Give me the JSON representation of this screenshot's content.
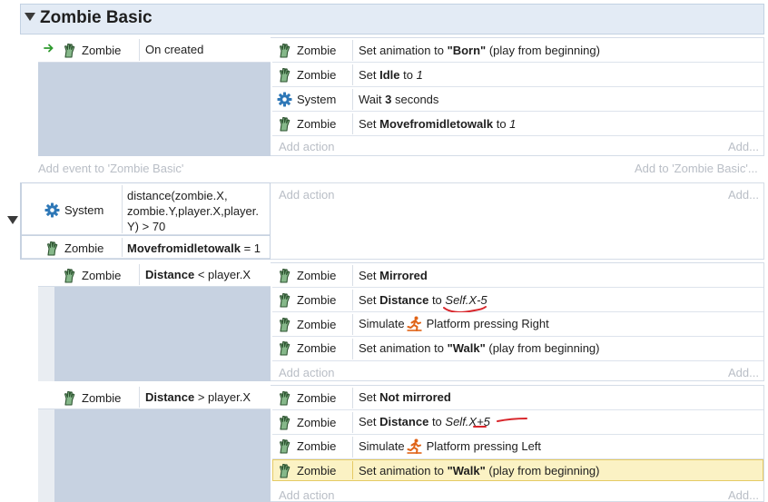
{
  "group": {
    "title": "Zombie Basic"
  },
  "event1": {
    "condition": {
      "object": "Zombie",
      "text": "On created"
    },
    "actions": [
      {
        "object": "Zombie",
        "icon": "zombie-hand-icon",
        "pre": "Set animation to ",
        "bold": "\"Born\"",
        "post": " (play from beginning)"
      },
      {
        "object": "Zombie",
        "icon": "zombie-hand-icon",
        "pre": "Set ",
        "bold": "Idle",
        "mid": " to ",
        "ital": "1"
      },
      {
        "object": "System",
        "icon": "gear-icon",
        "pre": "Wait ",
        "bold": "3",
        "post": " seconds"
      },
      {
        "object": "Zombie",
        "icon": "zombie-hand-icon",
        "pre": "Set ",
        "bold": "Movefromidletowalk",
        "mid": " to ",
        "ital": "1"
      }
    ],
    "add_action": "Add action",
    "add_more": "Add..."
  },
  "add_event": {
    "left": "Add event to 'Zombie Basic'",
    "right": "Add to 'Zombie Basic'..."
  },
  "event2": {
    "conditions": [
      {
        "object": "System",
        "icon": "gear-icon",
        "lines": [
          "distance(zombie.X,",
          "zombie.Y,player.X,player.",
          "Y) > 70"
        ]
      },
      {
        "object": "Zombie",
        "icon": "zombie-hand-icon",
        "bold": "Movefromidletowalk",
        "post": " = 1"
      }
    ],
    "add_action": "Add action",
    "add_more": "Add..."
  },
  "sub1": {
    "condition": {
      "object": "Zombie",
      "bold": "Distance",
      "post": " < player.X"
    },
    "actions": [
      {
        "object": "Zombie",
        "pre": "Set ",
        "bold": "Mirrored"
      },
      {
        "object": "Zombie",
        "pre": "Set ",
        "bold": "Distance",
        "mid": " to ",
        "ital": "Self.X-5"
      },
      {
        "object": "Zombie",
        "pre": "Simulate ",
        "post": "Platform pressing Right"
      },
      {
        "object": "Zombie",
        "pre": "Set animation to ",
        "bold": "\"Walk\"",
        "post": " (play from beginning)"
      }
    ],
    "add_action": "Add action",
    "add_more": "Add..."
  },
  "sub2": {
    "condition": {
      "object": "Zombie",
      "bold": "Distance",
      "post": " > player.X"
    },
    "actions": [
      {
        "object": "Zombie",
        "pre": "Set ",
        "bold": "Not mirrored"
      },
      {
        "object": "Zombie",
        "pre": "Set ",
        "bold": "Distance",
        "mid": " to ",
        "ital": "Self.X+5"
      },
      {
        "object": "Zombie",
        "pre": "Simulate ",
        "post": "Platform pressing Left"
      },
      {
        "object": "Zombie",
        "pre": "Set animation to ",
        "bold": "\"Walk\"",
        "post": " (play from beginning)"
      }
    ],
    "add_action": "Add action",
    "add_more": "Add..."
  },
  "colors": {
    "zombie": "#4e7f52",
    "gear": "#2f78b7",
    "run": "#e06418",
    "selected": "#fbf2c4",
    "annotation": "#d8262b"
  }
}
